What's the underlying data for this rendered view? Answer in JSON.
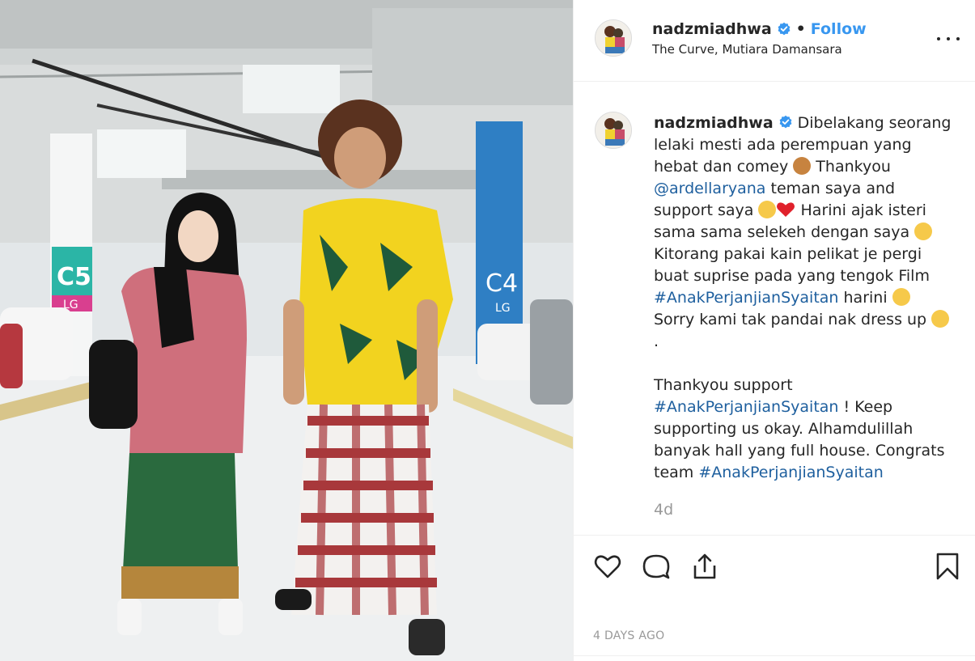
{
  "post": {
    "username": "nadzmiadhwa",
    "follow_label": "Follow",
    "location": "The Curve, Mutiara Damansara",
    "caption_user": "nadzmiadhwa",
    "caption_1": "Dibelakang seorang lelaki mesti ada perempuan yang hebat dan comey ",
    "caption_2": " Thankyou ",
    "mention": "@ardellaryana",
    "caption_3": " teman saya and support saya ",
    "caption_4": " Harini ajak isteri sama sama selekeh dengan saya ",
    "caption_5": " Kitorang pakai kain pelikat je pergi buat suprise pada yang tengok Film ",
    "hashtag_1": "#AnakPerjanjianSyaitan",
    "caption_6": " harini ",
    "caption_7": " Sorry kami tak pandai nak dress up ",
    "caption_8": "\n.\n\nThankyou support\n",
    "hashtag_2": "#AnakPerjanjianSyaitan",
    "caption_9": " ! Keep supporting us okay. Alhamdulillah banyak hall yang full house. Congrats team ",
    "hashtag_3": "#AnakPerjanjianSyaitan",
    "age": "4d",
    "date": "4 DAYS AGO"
  },
  "icons": {
    "verified": "verified-badge-icon",
    "more": "more-options-icon",
    "like": "heart-icon",
    "comment": "comment-icon",
    "share": "share-icon",
    "save": "bookmark-icon"
  },
  "colors": {
    "follow": "#3897f0",
    "link": "#1e5f9e",
    "verified": "#3897f0",
    "muted": "#999999"
  },
  "photo_signs": {
    "pillar_left": "C5",
    "pillar_left_sub": "LG",
    "pillar_right": "C4",
    "pillar_right_sub": "LG"
  }
}
